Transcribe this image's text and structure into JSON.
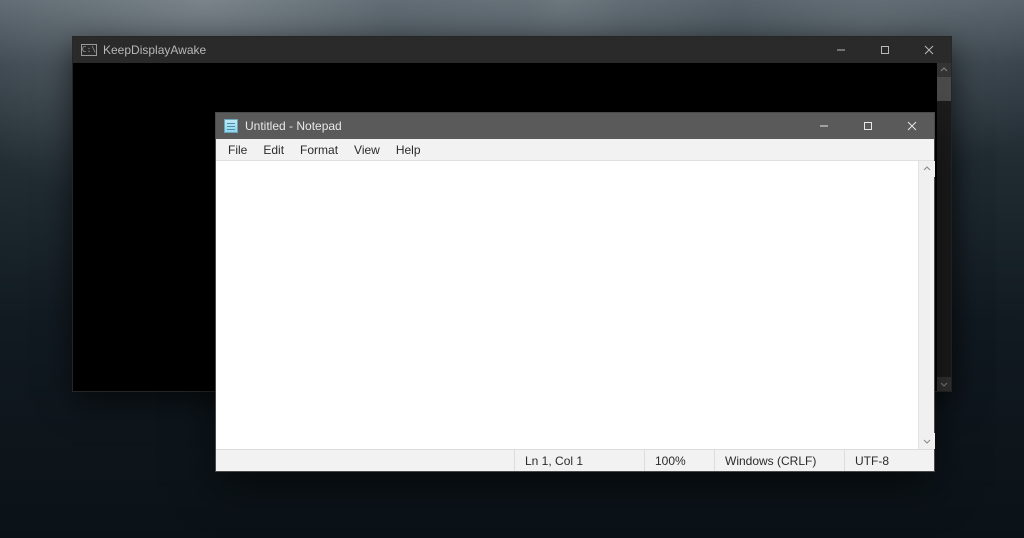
{
  "bgwin": {
    "title": "KeepDisplayAwake",
    "icon_glyph": "C:\\"
  },
  "notepad": {
    "title": "Untitled - Notepad",
    "menu": {
      "file": "File",
      "edit": "Edit",
      "format": "Format",
      "view": "View",
      "help": "Help"
    },
    "content": "",
    "status": {
      "position": "Ln 1, Col 1",
      "zoom": "100%",
      "line_ending": "Windows (CRLF)",
      "encoding": "UTF-8"
    }
  }
}
